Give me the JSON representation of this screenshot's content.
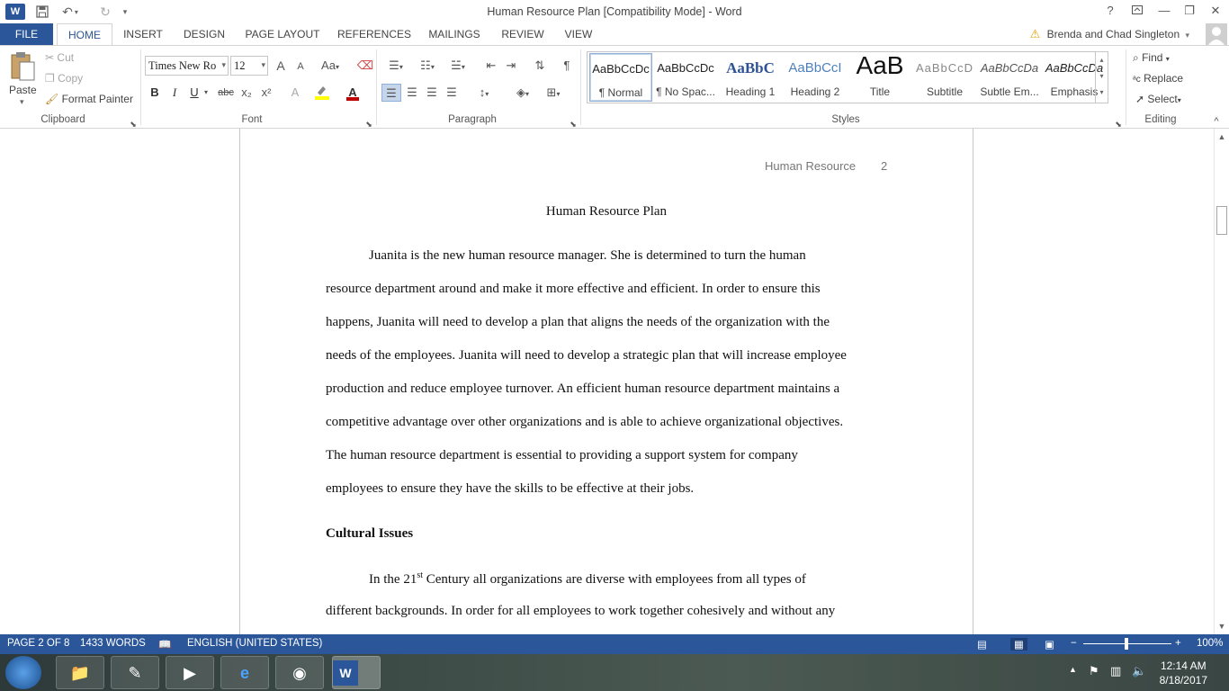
{
  "window": {
    "title": "Human Resource Plan [Compatibility Mode] - Word",
    "help_glyph": "?",
    "undo_glyph": "↶",
    "redo_glyph": "↻"
  },
  "tabs": [
    "FILE",
    "HOME",
    "INSERT",
    "DESIGN",
    "PAGE LAYOUT",
    "REFERENCES",
    "MAILINGS",
    "REVIEW",
    "VIEW"
  ],
  "user": {
    "name": "Brenda and Chad Singleton"
  },
  "clipboard": {
    "paste": "Paste",
    "cut": "Cut",
    "copy": "Copy",
    "format_painter": "Format Painter",
    "label": "Clipboard"
  },
  "font": {
    "name": "Times New Ro",
    "size": "12",
    "label": "Font",
    "bold": "B",
    "italic": "I",
    "underline": "U",
    "strike": "abc",
    "subscript": "x₂",
    "superscript": "x²",
    "grow": "A",
    "shrink": "A",
    "case": "Aa",
    "effects": "A",
    "color": "A"
  },
  "paragraph": {
    "label": "Paragraph"
  },
  "styles": {
    "label": "Styles",
    "items": [
      {
        "preview": "AaBbCcDc",
        "name": "¶ Normal"
      },
      {
        "preview": "AaBbCcDc",
        "name": "¶ No Spac..."
      },
      {
        "preview": "AaBbC",
        "name": "Heading 1"
      },
      {
        "preview": "AaBbCcI",
        "name": "Heading 2"
      },
      {
        "preview": "AaB",
        "name": "Title"
      },
      {
        "preview": "AaBbCcD",
        "name": "Subtitle"
      },
      {
        "preview": "AaBbCcDa",
        "name": "Subtle Em..."
      },
      {
        "preview": "AaBbCcDa",
        "name": "Emphasis"
      }
    ]
  },
  "editing": {
    "find": "Find",
    "replace": "Replace",
    "select": "Select",
    "label": "Editing"
  },
  "document": {
    "header": "Human Resource",
    "page_number": "2",
    "title": "Human Resource Plan",
    "para1": [
      "Juanita is the new human resource manager. She is determined to turn the human",
      "resource department around and make it more effective and efficient. In order to ensure this",
      "happens, Juanita will need to develop a plan that aligns the needs of the organization with the",
      "needs of the employees. Juanita will need to develop a strategic plan that will increase employee",
      "production and reduce employee turnover. An efficient human resource department maintains a",
      "competitive advantage over other organizations and is able to achieve organizational objectives.",
      "The human resource department is essential to providing a support system for company",
      "employees to ensure they have the skills to be effective at their jobs."
    ],
    "heading": "Cultural Issues",
    "para2_line1_pre": "In the 21",
    "para2_line1_sup": "st",
    "para2_line1_post": " Century all organizations are diverse with employees from all types of",
    "para2_line2": "different backgrounds. In order for all employees to work together cohesively and without any"
  },
  "status": {
    "page": "PAGE 2 OF 8",
    "words": "1433 WORDS",
    "language": "ENGLISH (UNITED STATES)",
    "zoom": "100%"
  },
  "taskbar": {
    "time": "12:14 AM",
    "date": "8/18/2017"
  },
  "colors": {
    "accent": "#2b579a",
    "highlight": "#ffff00",
    "font_color": "#c00000"
  }
}
